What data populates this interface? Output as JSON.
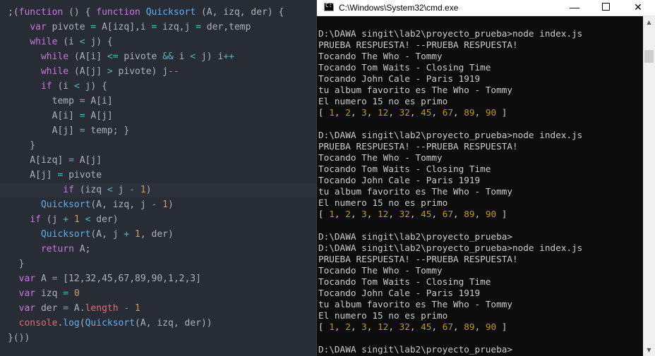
{
  "editor": {
    "lines": [
      [
        [
          "pl",
          ";("
        ],
        [
          "kw",
          "function"
        ],
        [
          "pl",
          " () { "
        ],
        [
          "kw",
          "function"
        ],
        [
          "pl",
          " "
        ],
        [
          "fn",
          "Quicksort"
        ],
        [
          "pl",
          " (A, izq, der) {"
        ]
      ],
      [
        [
          "pl",
          "    "
        ],
        [
          "kw",
          "var"
        ],
        [
          "pl",
          " pivote "
        ],
        [
          "op",
          "="
        ],
        [
          "pl",
          " A[izq],i "
        ],
        [
          "op",
          "="
        ],
        [
          "pl",
          " izq,j "
        ],
        [
          "op",
          "="
        ],
        [
          "pl",
          " der,temp"
        ]
      ],
      [
        [
          "pl",
          "    "
        ],
        [
          "kw",
          "while"
        ],
        [
          "pl",
          " (i "
        ],
        [
          "op",
          "<"
        ],
        [
          "pl",
          " j) {"
        ]
      ],
      [
        [
          "pl",
          "      "
        ],
        [
          "kw",
          "while"
        ],
        [
          "pl",
          " (A[i] "
        ],
        [
          "op",
          "<="
        ],
        [
          "pl",
          " pivote "
        ],
        [
          "op",
          "&&"
        ],
        [
          "pl",
          " i "
        ],
        [
          "op",
          "<"
        ],
        [
          "pl",
          " j) i"
        ],
        [
          "op",
          "++"
        ]
      ],
      [
        [
          "pl",
          "      "
        ],
        [
          "kw",
          "while"
        ],
        [
          "pl",
          " (A[j] "
        ],
        [
          "op",
          ">"
        ],
        [
          "pl",
          " pivote) j"
        ],
        [
          "op",
          "--"
        ]
      ],
      [
        [
          "pl",
          "      "
        ],
        [
          "kw",
          "if"
        ],
        [
          "pl",
          " (i "
        ],
        [
          "op",
          "<"
        ],
        [
          "pl",
          " j) {"
        ]
      ],
      [
        [
          "pl",
          "        temp "
        ],
        [
          "op",
          "="
        ],
        [
          "pl",
          " A[i]"
        ]
      ],
      [
        [
          "pl",
          "        A[i] "
        ],
        [
          "op",
          "="
        ],
        [
          "pl",
          " A[j]"
        ]
      ],
      [
        [
          "pl",
          "        A[j] "
        ],
        [
          "op",
          "="
        ],
        [
          "pl",
          " temp; }"
        ]
      ],
      [
        [
          "pl",
          "    }"
        ]
      ],
      [
        [
          "pl",
          "    A[izq] "
        ],
        [
          "op",
          "="
        ],
        [
          "pl",
          " A[j]"
        ]
      ],
      [
        [
          "pl",
          "    A[j] "
        ],
        [
          "op",
          "="
        ],
        [
          "pl",
          " pivote"
        ]
      ],
      [
        [
          "pl",
          "          "
        ],
        [
          "kw",
          "if"
        ],
        [
          "pl",
          " (izq "
        ],
        [
          "op",
          "<"
        ],
        [
          "pl",
          " j "
        ],
        [
          "op",
          "-"
        ],
        [
          "pl",
          " "
        ],
        [
          "num",
          "1"
        ],
        [
          "pl",
          ")"
        ]
      ],
      [
        [
          "pl",
          "      "
        ],
        [
          "fn",
          "Quicksort"
        ],
        [
          "pl",
          "(A, izq, j "
        ],
        [
          "op",
          "-"
        ],
        [
          "pl",
          " "
        ],
        [
          "num",
          "1"
        ],
        [
          "pl",
          ")"
        ]
      ],
      [
        [
          "pl",
          "    "
        ],
        [
          "kw",
          "if"
        ],
        [
          "pl",
          " (j "
        ],
        [
          "op",
          "+"
        ],
        [
          "pl",
          " "
        ],
        [
          "num",
          "1"
        ],
        [
          "pl",
          " "
        ],
        [
          "op",
          "<"
        ],
        [
          "pl",
          " der)"
        ]
      ],
      [
        [
          "pl",
          "      "
        ],
        [
          "fn",
          "Quicksort"
        ],
        [
          "pl",
          "(A, j "
        ],
        [
          "op",
          "+"
        ],
        [
          "pl",
          " "
        ],
        [
          "num",
          "1"
        ],
        [
          "pl",
          ", der)"
        ]
      ],
      [
        [
          "pl",
          "      "
        ],
        [
          "kw",
          "return"
        ],
        [
          "pl",
          " A;"
        ]
      ],
      [
        [
          "pl",
          "  }"
        ]
      ],
      [
        [
          "pl",
          "  "
        ],
        [
          "kw",
          "var"
        ],
        [
          "pl",
          " A "
        ],
        [
          "op",
          "="
        ],
        [
          "pl",
          " [12,32,45,67,89,90,1,2,3]"
        ]
      ],
      [
        [
          "pl",
          "  "
        ],
        [
          "kw",
          "var"
        ],
        [
          "pl",
          " izq "
        ],
        [
          "op",
          "="
        ],
        [
          "pl",
          " "
        ],
        [
          "num",
          "0"
        ]
      ],
      [
        [
          "pl",
          "  "
        ],
        [
          "kw",
          "var"
        ],
        [
          "pl",
          " der "
        ],
        [
          "op",
          "="
        ],
        [
          "pl",
          " A."
        ],
        [
          "var",
          "length"
        ],
        [
          "pl",
          " "
        ],
        [
          "op",
          "-"
        ],
        [
          "pl",
          " "
        ],
        [
          "num",
          "1"
        ]
      ],
      [
        [
          "pl",
          "  "
        ],
        [
          "var",
          "console"
        ],
        [
          "pl",
          "."
        ],
        [
          "fn",
          "log"
        ],
        [
          "pl",
          "("
        ],
        [
          "fn",
          "Quicksort"
        ],
        [
          "pl",
          "(A, izq, der))"
        ]
      ],
      [
        [
          "pl",
          "}())"
        ]
      ]
    ],
    "highlighted_line": 12
  },
  "console": {
    "title": "C:\\Windows\\System32\\cmd.exe",
    "icon": "cmd-icon",
    "buttons": {
      "minimize": "—",
      "close": "✕"
    },
    "scroll": {
      "up": "▲",
      "down": "▼"
    },
    "lines": [
      "",
      "D:\\DAWA singit\\lab2\\proyecto_prueba>node index.js",
      "PRUEBA RESPUESTA! --PRUEBA RESPUESTA!",
      "Tocando The Who - Tommy",
      "Tocando Tom Waits - Closing Time",
      "Tocando John Cale - Paris 1919",
      "tu album favorito es The Who - Tommy",
      "El numero 15 no es primo",
      "[ 1, 2, 3, 12, 32, 45, 67, 89, 90 ]",
      "",
      "D:\\DAWA singit\\lab2\\proyecto_prueba>node index.js",
      "PRUEBA RESPUESTA! --PRUEBA RESPUESTA!",
      "Tocando The Who - Tommy",
      "Tocando Tom Waits - Closing Time",
      "Tocando John Cale - Paris 1919",
      "tu album favorito es The Who - Tommy",
      "El numero 15 no es primo",
      "[ 1, 2, 3, 12, 32, 45, 67, 89, 90 ]",
      "",
      "D:\\DAWA singit\\lab2\\proyecto_prueba>",
      "D:\\DAWA singit\\lab2\\proyecto_prueba>node index.js",
      "PRUEBA RESPUESTA! --PRUEBA RESPUESTA!",
      "Tocando The Who - Tommy",
      "Tocando Tom Waits - Closing Time",
      "Tocando John Cale - Paris 1919",
      "tu album favorito es The Who - Tommy",
      "El numero 15 no es primo",
      "[ 1, 2, 3, 12, 32, 45, 67, 89, 90 ]",
      "",
      "D:\\DAWA singit\\lab2\\proyecto_prueba>"
    ],
    "array_numbers": [
      "1",
      "2",
      "3",
      "12",
      "32",
      "45",
      "67",
      "89",
      "90"
    ]
  }
}
